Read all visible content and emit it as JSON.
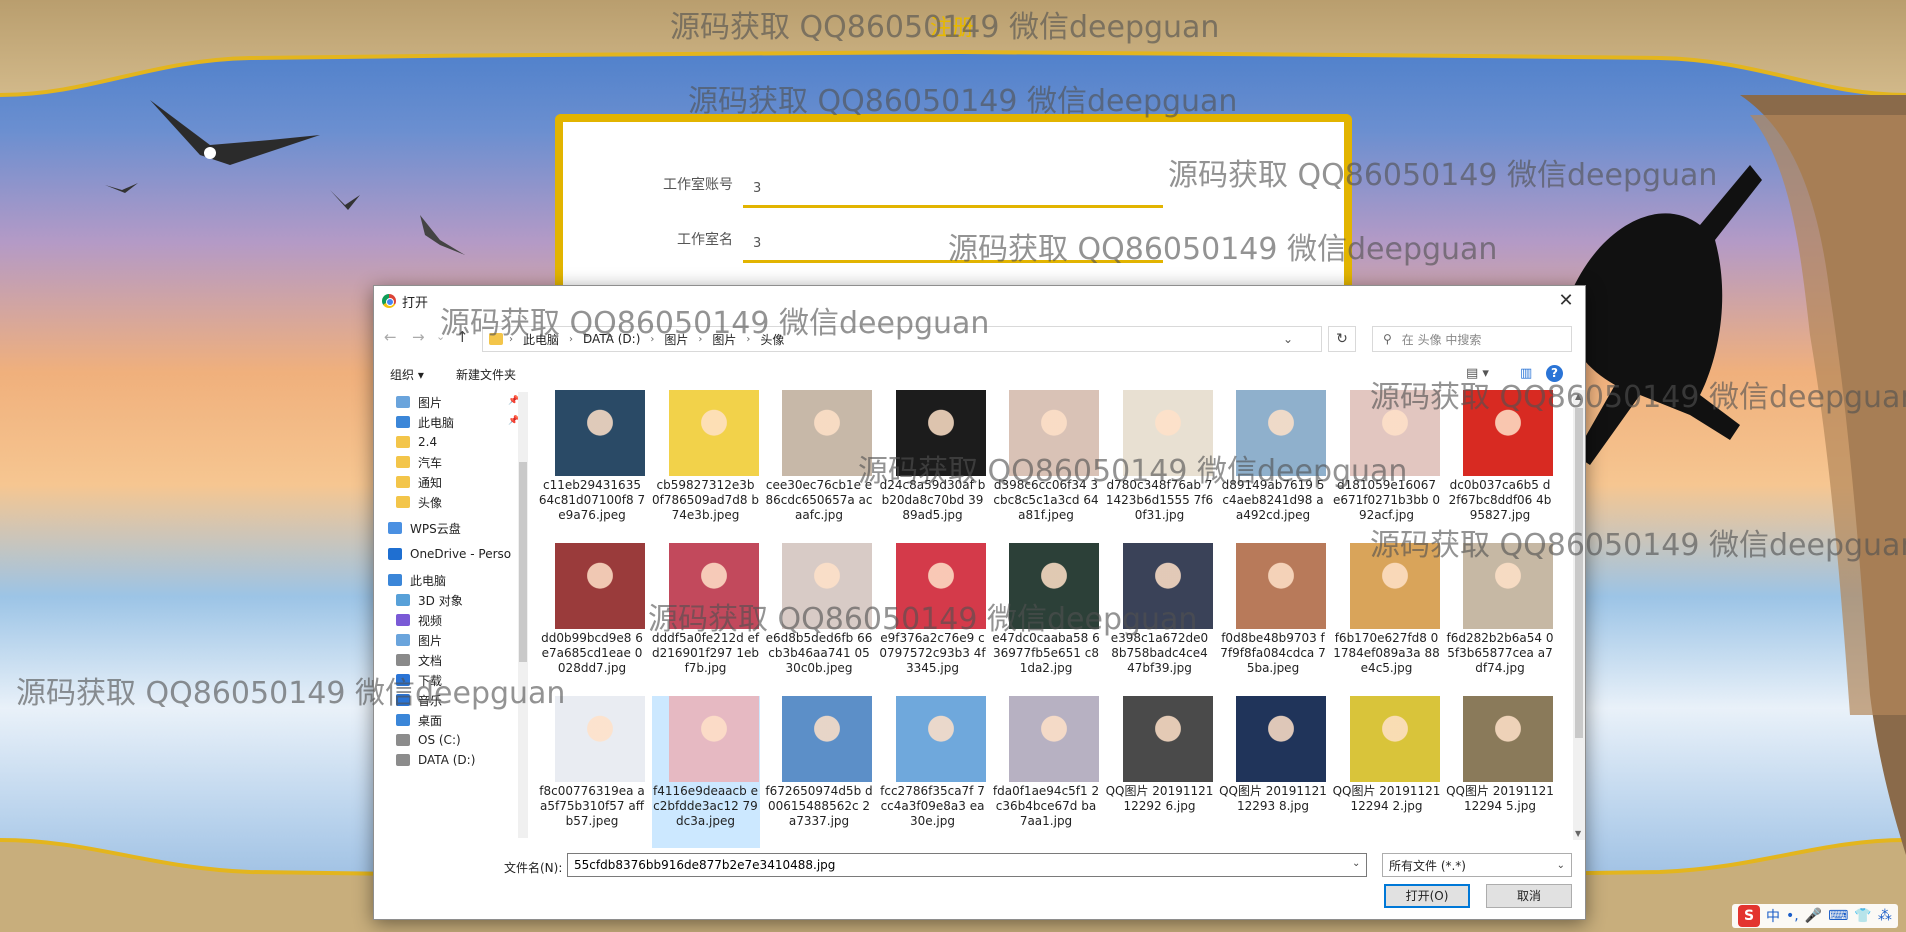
{
  "site": {
    "title": "注册"
  },
  "watermarks": [
    "源码获取 QQ86050149 微信deepguan",
    "源码获取 QQ86050149 微信deepguan",
    "源码获取 QQ86050149 微信deepguan",
    "源码获取 QQ86050149 微信deepguan",
    "源码获取 QQ86050149 微信deepguan",
    "源码获取 QQ86050149 微信deepguan",
    "源码获取 QQ86050149 微信deepguan",
    "源码获取 QQ86050149 微信deepguan",
    "源码获取 QQ86050149 微信deepguan",
    "源码获取 QQ86050149 微信deepguan"
  ],
  "form": {
    "studio_account_label": "工作室账号",
    "studio_account_value": "3",
    "studio_name_label": "工作室名",
    "studio_name_value": "3"
  },
  "dialog": {
    "title": "打开",
    "close": "✕",
    "nav": {
      "back": "←",
      "forward": "→",
      "recent": "⌄",
      "up": "↑"
    },
    "breadcrumb": [
      "此电脑",
      "DATA (D:)",
      "图片",
      "图片",
      "头像"
    ],
    "refresh": "↻",
    "search_placeholder": "在 头像 中搜索",
    "toolbar": {
      "organize": "组织 ▾",
      "new_folder": "新建文件夹"
    },
    "nav_pane": [
      {
        "label": "图片",
        "icon": "pictures-icon",
        "pinned": true
      },
      {
        "label": "此电脑",
        "icon": "computer-icon",
        "pinned": true
      },
      {
        "label": "2.4",
        "icon": "folder-icon"
      },
      {
        "label": "汽车",
        "icon": "folder-icon"
      },
      {
        "label": "通知",
        "icon": "folder-icon"
      },
      {
        "label": "头像",
        "icon": "folder-icon"
      },
      {
        "label": "WPS云盘",
        "icon": "cloud-icon"
      },
      {
        "label": "OneDrive - Perso",
        "icon": "onedrive-icon"
      },
      {
        "label": "此电脑",
        "icon": "computer-icon"
      },
      {
        "label": "3D 对象",
        "icon": "cube-icon"
      },
      {
        "label": "视频",
        "icon": "video-icon"
      },
      {
        "label": "图片",
        "icon": "pictures-icon"
      },
      {
        "label": "文档",
        "icon": "document-icon"
      },
      {
        "label": "下载",
        "icon": "download-icon"
      },
      {
        "label": "音乐",
        "icon": "music-icon"
      },
      {
        "label": "桌面",
        "icon": "desktop-icon"
      },
      {
        "label": "OS (C:)",
        "icon": "drive-icon"
      },
      {
        "label": "DATA (D:)",
        "icon": "drive-icon"
      }
    ],
    "files": [
      {
        "name": "c11eb29431635 64c81d07100f8 7e9a76.jpeg",
        "color": "#2a4a66"
      },
      {
        "name": "cb59827312e3b 0f786509ad7d8 b74e3b.jpeg",
        "color": "#f2d24a"
      },
      {
        "name": "cee30ec76cb1e e86cdc650657a acaafc.jpg",
        "color": "#c7b8a8"
      },
      {
        "name": "d24c8a59d30af bb20da8c70bd 3989ad5.jpg",
        "color": "#1c1c1c"
      },
      {
        "name": "d398c6cc06f34 3cbc8c5c1a3cd 64a81f.jpeg",
        "color": "#d9c2b6"
      },
      {
        "name": "d780c348f76ab 71423b6d1555 7f60f31.jpg",
        "color": "#e8e0d2"
      },
      {
        "name": "d89149ab7619 5c4aeb8241d98 aa492cd.jpeg",
        "color": "#8fb0cc"
      },
      {
        "name": "d181059e16067 e671f0271b3bb 092acf.jpg",
        "color": "#e2c6c0"
      },
      {
        "name": "dc0b037ca6b5 d2f67bc8ddf06 4b95827.jpg",
        "color": "#d82a22"
      },
      {
        "name": "dd0b99bcd9e8 6e7a685cd1eae 0028dd7.jpg",
        "color": "#9a3b3b"
      },
      {
        "name": "dddf5a0fe212d efd216901f297 1ebf7b.jpg",
        "color": "#c2495c"
      },
      {
        "name": "e6d8b5ded6fb 66cb3b46aa741 0530c0b.jpeg",
        "color": "#d8cbc6"
      },
      {
        "name": "e9f376a2c76e9 c0797572c93b3 4f3345.jpg",
        "color": "#d43a4a"
      },
      {
        "name": "e47dc0caaba58 636977fb5e651 c81da2.jpg",
        "color": "#2c4038"
      },
      {
        "name": "e398c1a672de0 8b758badc4ce4 47bf39.jpg",
        "color": "#3a4258"
      },
      {
        "name": "f0d8be48b9703 f7f9f8fa084cdca 75ba.jpeg",
        "color": "#b87a5a"
      },
      {
        "name": "f6b170e627fd8 01784ef089a3a 88e4c5.jpg",
        "color": "#d9a45a"
      },
      {
        "name": "f6d282b2b6a54 05f3b65877cea a7df74.jpg",
        "color": "#c6b8a4"
      },
      {
        "name": "f8c00776319ea aa5f75b310f57 affb57.jpeg",
        "color": "#e9ecf2"
      },
      {
        "name": "f4116e9deaacb ec2bfdde3ac12 79dc3a.jpeg",
        "color": "#e6b9c2",
        "selected": true
      },
      {
        "name": "f672650974d5b d00615488562c 2a7337.jpg",
        "color": "#5c8fc8"
      },
      {
        "name": "fcc2786f35ca7f 7cc4a3f09e8a3 ea30e.jpg",
        "color": "#6fa8dc"
      },
      {
        "name": "fda0f1ae94c5f1 2c36b4bce67d ba7aa1.jpg",
        "color": "#b7b1c2"
      },
      {
        "name": "QQ图片 2019112112292 6.jpg",
        "color": "#4a4a4a"
      },
      {
        "name": "QQ图片 2019112112293 8.jpg",
        "color": "#20345a"
      },
      {
        "name": "QQ图片 2019112112294 2.jpg",
        "color": "#d9c43a"
      },
      {
        "name": "QQ图片 2019112112294 5.jpg",
        "color": "#8a7a5a"
      }
    ],
    "filename_label": "文件名(N):",
    "filename_value": "55cfdb8376bb916de877b2e7e3410488.jpg",
    "filetype": "所有文件 (*.*)",
    "open_button": "打开(O)",
    "cancel_button": "取消"
  },
  "ime": {
    "logo": "S",
    "mode": "中"
  }
}
